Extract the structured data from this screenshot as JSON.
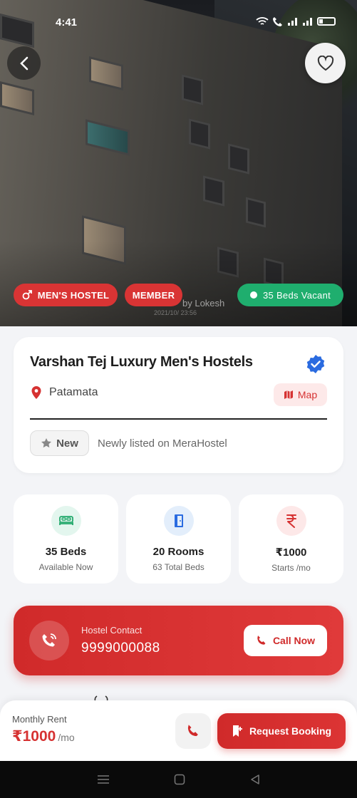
{
  "status_bar": {
    "time": "4:41"
  },
  "hero": {
    "watermark": "by Lokesh",
    "watermark_date": "2021/10/   23:56",
    "tags": {
      "type": "MEN'S HOSTEL",
      "member": "MEMBER",
      "vacancy": "35 Beds Vacant"
    }
  },
  "hostel": {
    "name": "Varshan Tej Luxury Men's Hostels",
    "location": "Patamata",
    "map_label": "Map",
    "badge": "New",
    "badge_text": "Newly listed on MeraHostel"
  },
  "stats": [
    {
      "value": "35 Beds",
      "sub": "Available Now",
      "icon": "bed-icon"
    },
    {
      "value": "20 Rooms",
      "sub": "63 Total Beds",
      "icon": "door-icon"
    },
    {
      "value": "₹1000",
      "sub": "Starts /mo",
      "icon": "rupee-icon"
    }
  ],
  "contact": {
    "label": "Hostel Contact",
    "number": "9999000088",
    "call_label": "Call Now"
  },
  "bottom_bar": {
    "rent_label": "Monthly Rent",
    "rent_value": "₹1000",
    "rent_unit": "/mo",
    "book_label": "Request Booking"
  },
  "colors": {
    "primary": "#d93434",
    "success": "#1fae6e",
    "verified": "#2a6be0"
  }
}
